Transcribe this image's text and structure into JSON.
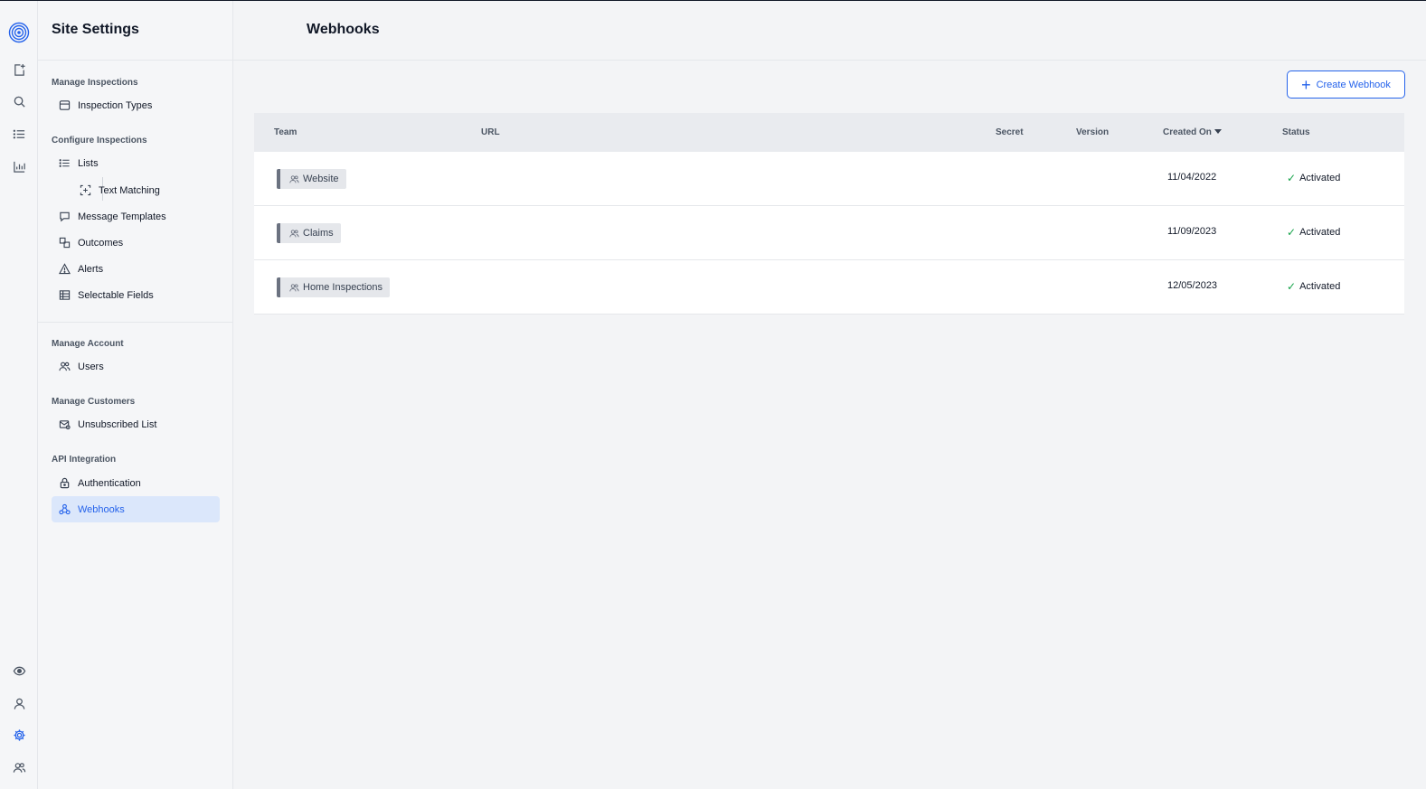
{
  "sidebar": {
    "title": "Site Settings",
    "sections": {
      "manage_inspections": "Manage Inspections",
      "configure_inspections": "Configure Inspections",
      "manage_account": "Manage Account",
      "manage_customers": "Manage Customers",
      "api_integration": "API Integration"
    },
    "items": {
      "inspection_types": "Inspection Types",
      "lists": "Lists",
      "text_matching": "Text Matching",
      "message_templates": "Message Templates",
      "outcomes": "Outcomes",
      "alerts": "Alerts",
      "selectable_fields": "Selectable Fields",
      "users": "Users",
      "unsubscribed_list": "Unsubscribed List",
      "authentication": "Authentication",
      "webhooks": "Webhooks"
    },
    "active_item": "Webhooks"
  },
  "rail": {
    "icons": [
      "logo-icon",
      "new-inspection-icon",
      "search-icon",
      "list-icon",
      "chart-icon",
      "eye-icon",
      "user-icon",
      "settings-icon",
      "team-icon"
    ],
    "active": "settings-icon",
    "accent_color": "#2563eb"
  },
  "main": {
    "title": "Webhooks",
    "create_button": "Create Webhook",
    "columns": {
      "team": "Team",
      "url": "URL",
      "secret": "Secret",
      "version": "Version",
      "created_on": "Created On",
      "status": "Status"
    },
    "sort": {
      "column": "created_on",
      "direction": "desc"
    },
    "rows": [
      {
        "team": "Website",
        "url": "",
        "secret": "",
        "version": "",
        "created_on": "11/04/2022",
        "status": "Activated"
      },
      {
        "team": "Claims",
        "url": "",
        "secret": "",
        "version": "",
        "created_on": "11/09/2023",
        "status": "Activated"
      },
      {
        "team": "Home Inspections",
        "url": "",
        "secret": "",
        "version": "",
        "created_on": "12/05/2023",
        "status": "Activated"
      }
    ]
  }
}
